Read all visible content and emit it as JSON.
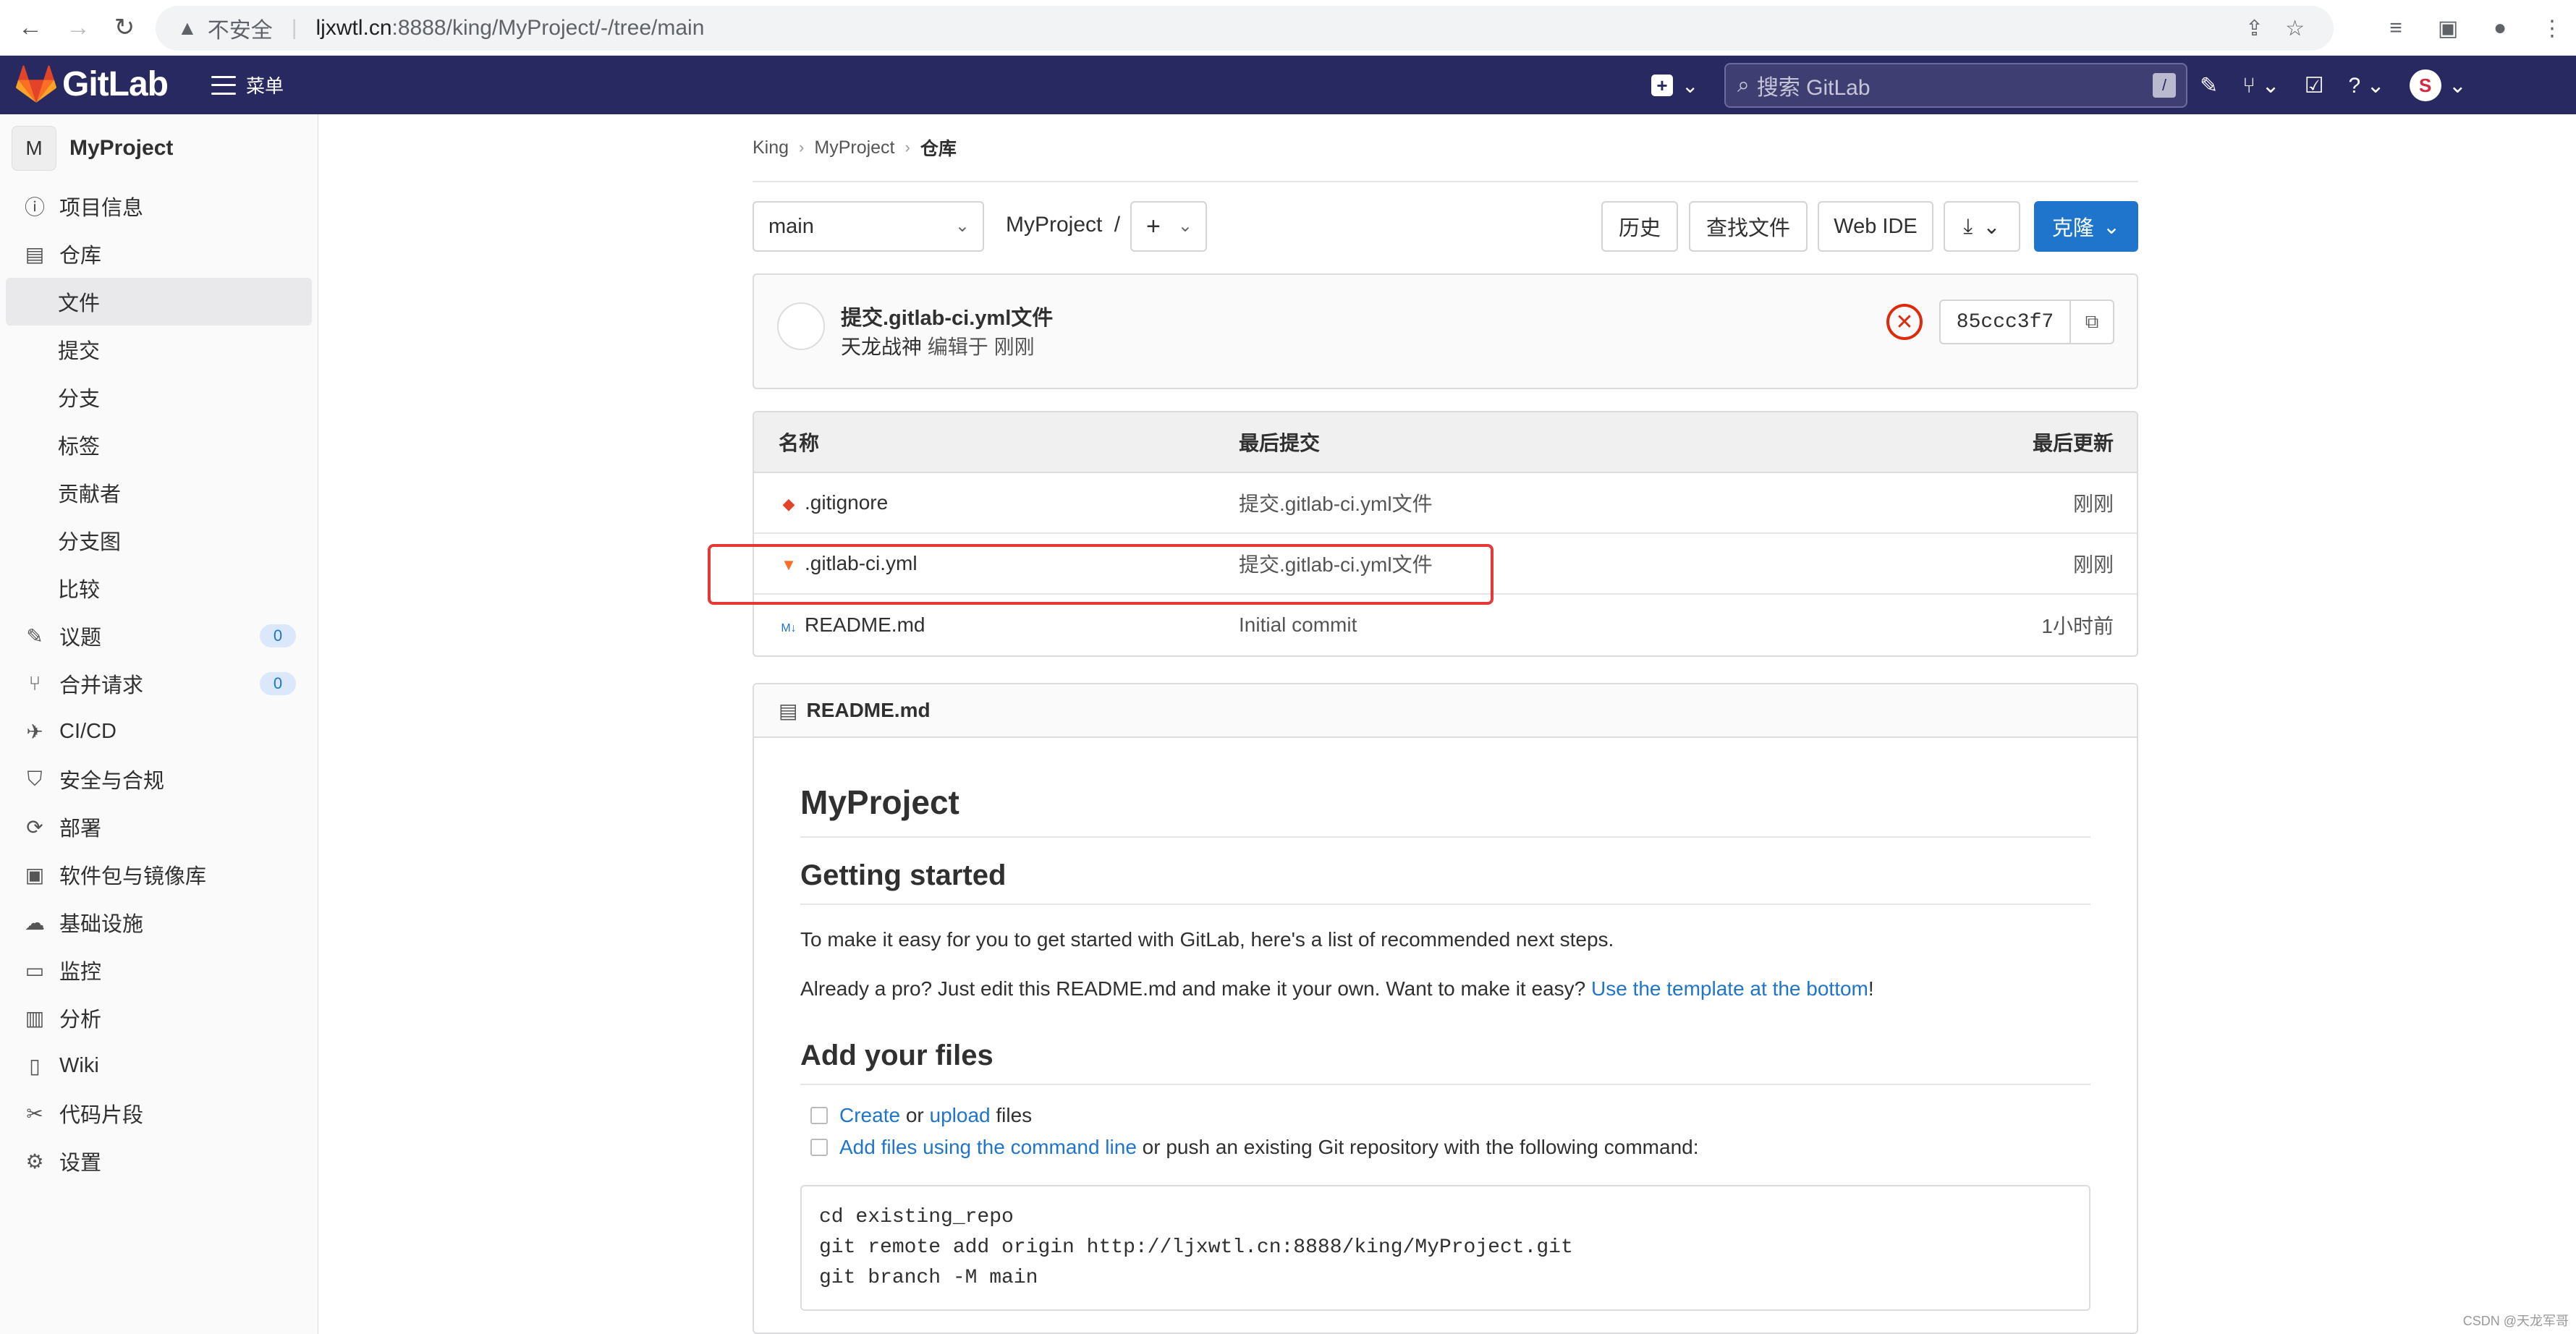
{
  "browser": {
    "insecure_label": "不安全",
    "url_host": "ljxwtl.cn",
    "url_path": ":8888/king/MyProject/-/tree/main"
  },
  "header": {
    "brand": "GitLab",
    "menu_label": "菜单",
    "search_placeholder": "搜索 GitLab",
    "search_shortcut": "/",
    "avatar_letter": "S"
  },
  "sidebar": {
    "project_initial": "M",
    "project_name": "MyProject",
    "items": [
      {
        "label": "项目信息"
      },
      {
        "label": "仓库"
      },
      {
        "label": "文件"
      },
      {
        "label": "提交"
      },
      {
        "label": "分支"
      },
      {
        "label": "标签"
      },
      {
        "label": "贡献者"
      },
      {
        "label": "分支图"
      },
      {
        "label": "比较"
      },
      {
        "label": "议题",
        "badge": "0"
      },
      {
        "label": "合并请求",
        "badge": "0"
      },
      {
        "label": "CI/CD"
      },
      {
        "label": "安全与合规"
      },
      {
        "label": "部署"
      },
      {
        "label": "软件包与镜像库"
      },
      {
        "label": "基础设施"
      },
      {
        "label": "监控"
      },
      {
        "label": "分析"
      },
      {
        "label": "Wiki"
      },
      {
        "label": "代码片段"
      },
      {
        "label": "设置"
      }
    ]
  },
  "breadcrumb": [
    "King",
    "MyProject",
    "仓库"
  ],
  "toolbar": {
    "branch": "main",
    "path": "MyProject",
    "path_sep": "/",
    "add_label": "+",
    "history": "历史",
    "find_file": "查找文件",
    "web_ide": "Web IDE",
    "download_icon": "⤓",
    "clone": "克隆"
  },
  "last_commit": {
    "title": "提交.gitlab-ci.yml文件",
    "author": "天龙战神",
    "action": "编辑于 刚刚",
    "sha": "85ccc3f7",
    "status": "failed"
  },
  "file_table": {
    "headers": [
      "名称",
      "最后提交",
      "最后更新"
    ],
    "rows": [
      {
        "name": ".gitignore",
        "commit": "提交.gitlab-ci.yml文件",
        "updated": "刚刚"
      },
      {
        "name": ".gitlab-ci.yml",
        "commit": "提交.gitlab-ci.yml文件",
        "updated": "刚刚"
      },
      {
        "name": "README.md",
        "commit": "Initial commit",
        "updated": "1小时前"
      }
    ]
  },
  "readme": {
    "file": "README.md",
    "h1": "MyProject",
    "h2_start": "Getting started",
    "p1": "To make it easy for you to get started with GitLab, here's a list of recommended next steps.",
    "p2_pre": "Already a pro? Just edit this README.md and make it your own. Want to make it easy? ",
    "p2_link": "Use the template at the bottom",
    "p2_post": "!",
    "h2_files": "Add your files",
    "task1_create": "Create",
    "task1_or": " or ",
    "task1_upload": "upload",
    "task1_post": " files",
    "task2_link": "Add files using the command line",
    "task2_post": " or push an existing Git repository with the following command:",
    "code_lines": [
      "cd existing_repo",
      "git remote add origin http://ljxwtl.cn:8888/king/MyProject.git",
      "git branch -M main"
    ]
  },
  "watermark": "CSDN @天龙军哥",
  "colors": {
    "header_bg": "#292961",
    "primary": "#1f75cb",
    "danger": "#dd2b0e",
    "highlight_box": "#e53935"
  }
}
